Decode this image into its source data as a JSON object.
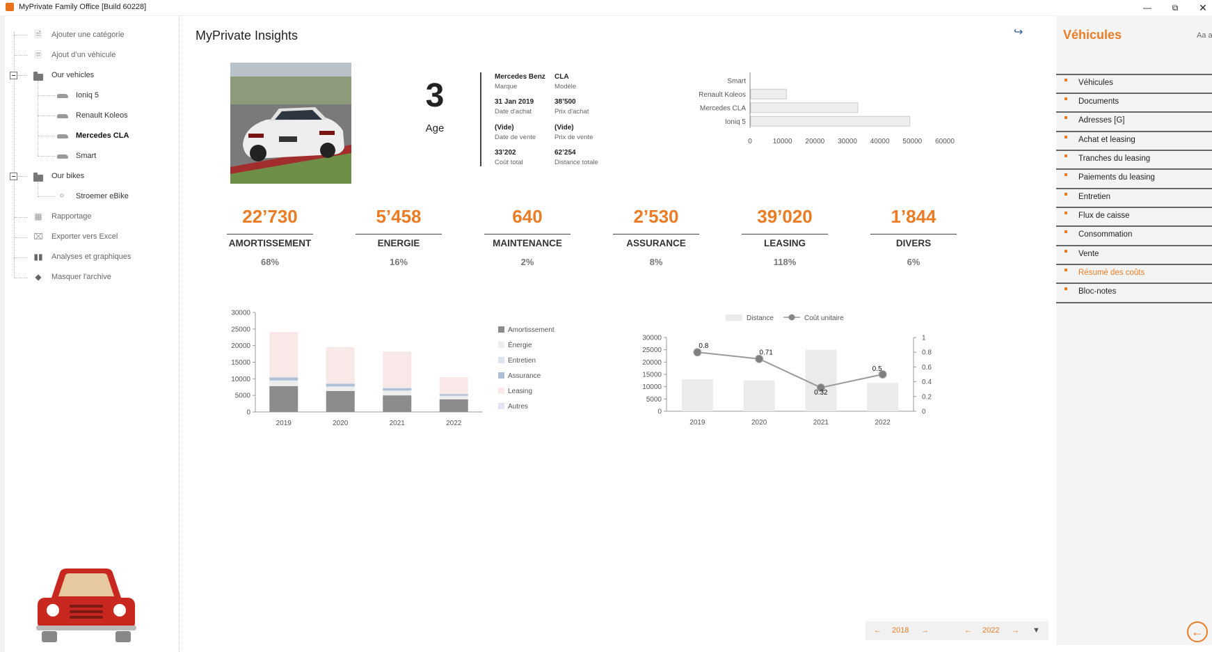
{
  "window": {
    "title": "MyPrivate Family Office [Build 60228]",
    "minimize_icon": "minimize-icon",
    "restore_icon": "restore-icon",
    "close_icon": "close-icon"
  },
  "tree": {
    "add_category": "Ajouter une catégorie",
    "add_vehicle": "Ajout d’un véhicule",
    "our_vehicles": "Our vehicles",
    "vehicles": [
      "Ioniq 5",
      "Renault Koleos",
      "Mercedes CLA",
      "Smart"
    ],
    "selected_vehicle": "Mercedes CLA",
    "our_bikes": "Our bikes",
    "bikes": [
      "Stroemer eBike"
    ],
    "reporting": "Rapportage",
    "export_excel": "Exporter vers Excel",
    "analyses": "Analyses et graphiques",
    "hide_archive": "Masquer l'archive"
  },
  "main": {
    "title": "MyPrivate Insights",
    "age_value": "3",
    "age_label": "Age",
    "info": {
      "brand": "Mercedes Benz",
      "brand_label": "Marque",
      "model": "CLA",
      "model_label": "Modèle",
      "purchase_date": "31 Jan 2019",
      "purchase_date_label": "Date d'achat",
      "purchase_price": "38’500",
      "purchase_price_label": "Prix d'achat",
      "sale_date": "(Vide)",
      "sale_date_label": "Date de vente",
      "sale_price": "(Vide)",
      "sale_price_label": "Prix de vente",
      "total_cost": "33’202",
      "total_cost_label": "Coût total",
      "total_distance": "62’254",
      "total_distance_label": "Distance totale"
    },
    "kpis": [
      {
        "value": "22’730",
        "label": "AMORTISSEMENT",
        "pct": "68%"
      },
      {
        "value": "5’458",
        "label": "ENERGIE",
        "pct": "16%"
      },
      {
        "value": "640",
        "label": "MAINTENANCE",
        "pct": "2%"
      },
      {
        "value": "2’530",
        "label": "ASSURANCE",
        "pct": "8%"
      },
      {
        "value": "39’020",
        "label": "LEASING",
        "pct": "118%"
      },
      {
        "value": "1’844",
        "label": "DIVERS",
        "pct": "6%"
      }
    ],
    "colors": {
      "accent": "#ea7c25"
    }
  },
  "pager": {
    "prev_icon": "arrow-left-icon",
    "start_year": "2018",
    "next_icon": "arrow-right-icon",
    "end_year": "2022",
    "filter_icon": "filter-icon"
  },
  "right_panel": {
    "title": "Véhicules",
    "font_hint": "Aa a",
    "items": [
      "Véhicules",
      "Documents",
      "Adresses [G]",
      "Achat et leasing",
      "Tranches du leasing",
      "Paiements du leasing",
      "Entretien",
      "Flux de caisse",
      "Consommation",
      "Vente",
      "Résumé des coûts",
      "Bloc-notes"
    ],
    "active_item": "Résumé des coûts",
    "back_icon": "back-arrow-icon"
  },
  "chart_data": [
    {
      "type": "bar",
      "orientation": "horizontal",
      "categories": [
        "Smart",
        "Renault Koleos",
        "Mercedes CLA",
        "Ioniq 5"
      ],
      "values": [
        0,
        11000,
        33000,
        49000
      ],
      "xlim": [
        0,
        60000
      ],
      "xticks": [
        0,
        10000,
        20000,
        30000,
        40000,
        50000,
        60000
      ],
      "grid": false
    },
    {
      "type": "bar",
      "stacked": true,
      "categories": [
        "2019",
        "2020",
        "2021",
        "2022"
      ],
      "series": [
        {
          "name": "Amortissement",
          "color": "#8c8c8c",
          "values": [
            7800,
            6300,
            5000,
            3800
          ]
        },
        {
          "name": "Énergie",
          "color": "#ededed",
          "values": [
            1500,
            1200,
            1300,
            900
          ]
        },
        {
          "name": "Entretien",
          "color": "#dde3f0",
          "values": [
            200,
            200,
            200,
            200
          ]
        },
        {
          "name": "Assurance",
          "color": "#aebfd8",
          "values": [
            900,
            800,
            700,
            500
          ]
        },
        {
          "name": "Leasing",
          "color": "#f8e8e8",
          "values": [
            13700,
            11000,
            11000,
            5100
          ]
        },
        {
          "name": "Autres",
          "color": "#e3e3ef",
          "values": [
            0,
            0,
            0,
            0
          ]
        }
      ],
      "ylim": [
        0,
        30000
      ],
      "yticks": [
        0,
        5000,
        10000,
        15000,
        20000,
        25000,
        30000
      ],
      "legend": "right"
    },
    {
      "type": "bar",
      "combo": "line",
      "categories": [
        "2019",
        "2020",
        "2021",
        "2022"
      ],
      "series": [
        {
          "name": "Distance",
          "type": "bar",
          "axis": "left",
          "color": "#ebebeb",
          "values": [
            13000,
            12500,
            25000,
            11500
          ]
        },
        {
          "name": "Coût unitaire",
          "type": "line",
          "axis": "right",
          "color": "#9a9a9a",
          "values": [
            0.8,
            0.71,
            0.32,
            0.5
          ],
          "labels": [
            "0.8",
            "0.71",
            "0.32",
            "0.5"
          ]
        }
      ],
      "ylim": [
        0,
        30000
      ],
      "yticks": [
        0,
        5000,
        10000,
        15000,
        20000,
        25000,
        30000
      ],
      "y2lim": [
        0,
        1
      ],
      "y2ticks": [
        0,
        0.2,
        0.4,
        0.6,
        0.8,
        1
      ],
      "legend": "top"
    }
  ]
}
